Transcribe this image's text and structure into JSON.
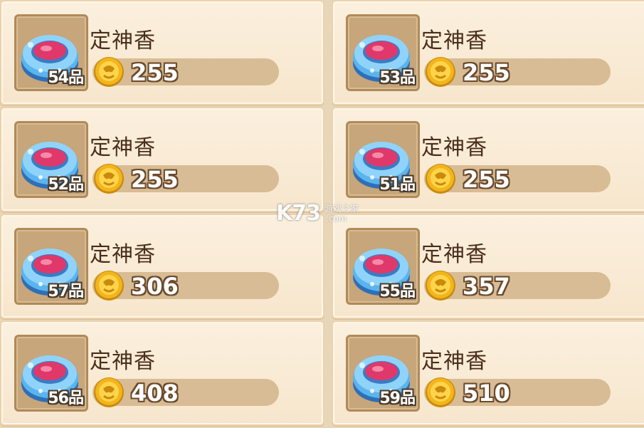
{
  "items": [
    {
      "name": "定神香",
      "grade": "54品",
      "price": "255"
    },
    {
      "name": "定神香",
      "grade": "53品",
      "price": "255"
    },
    {
      "name": "定神香",
      "grade": "52品",
      "price": "255"
    },
    {
      "name": "定神香",
      "grade": "51品",
      "price": "255"
    },
    {
      "name": "定神香",
      "grade": "57品",
      "price": "306"
    },
    {
      "name": "定神香",
      "grade": "55品",
      "price": "357"
    },
    {
      "name": "定神香",
      "grade": "56品",
      "price": "408"
    },
    {
      "name": "定神香",
      "grade": "59品",
      "price": "510"
    }
  ],
  "icons": {
    "item": "incense-censer-icon",
    "currency": "gold-coin-icon"
  },
  "watermark": {
    "main": "K73",
    "sub": "游戏之家",
    "url": ".com"
  },
  "colors": {
    "card_bg": "#fbf0de",
    "price_bar": "#d8bc95",
    "name_text": "#4a2e1a",
    "censer_blue": "#4aa6e8",
    "censer_pink": "#e0386a",
    "coin_gold": "#f2b51c"
  }
}
